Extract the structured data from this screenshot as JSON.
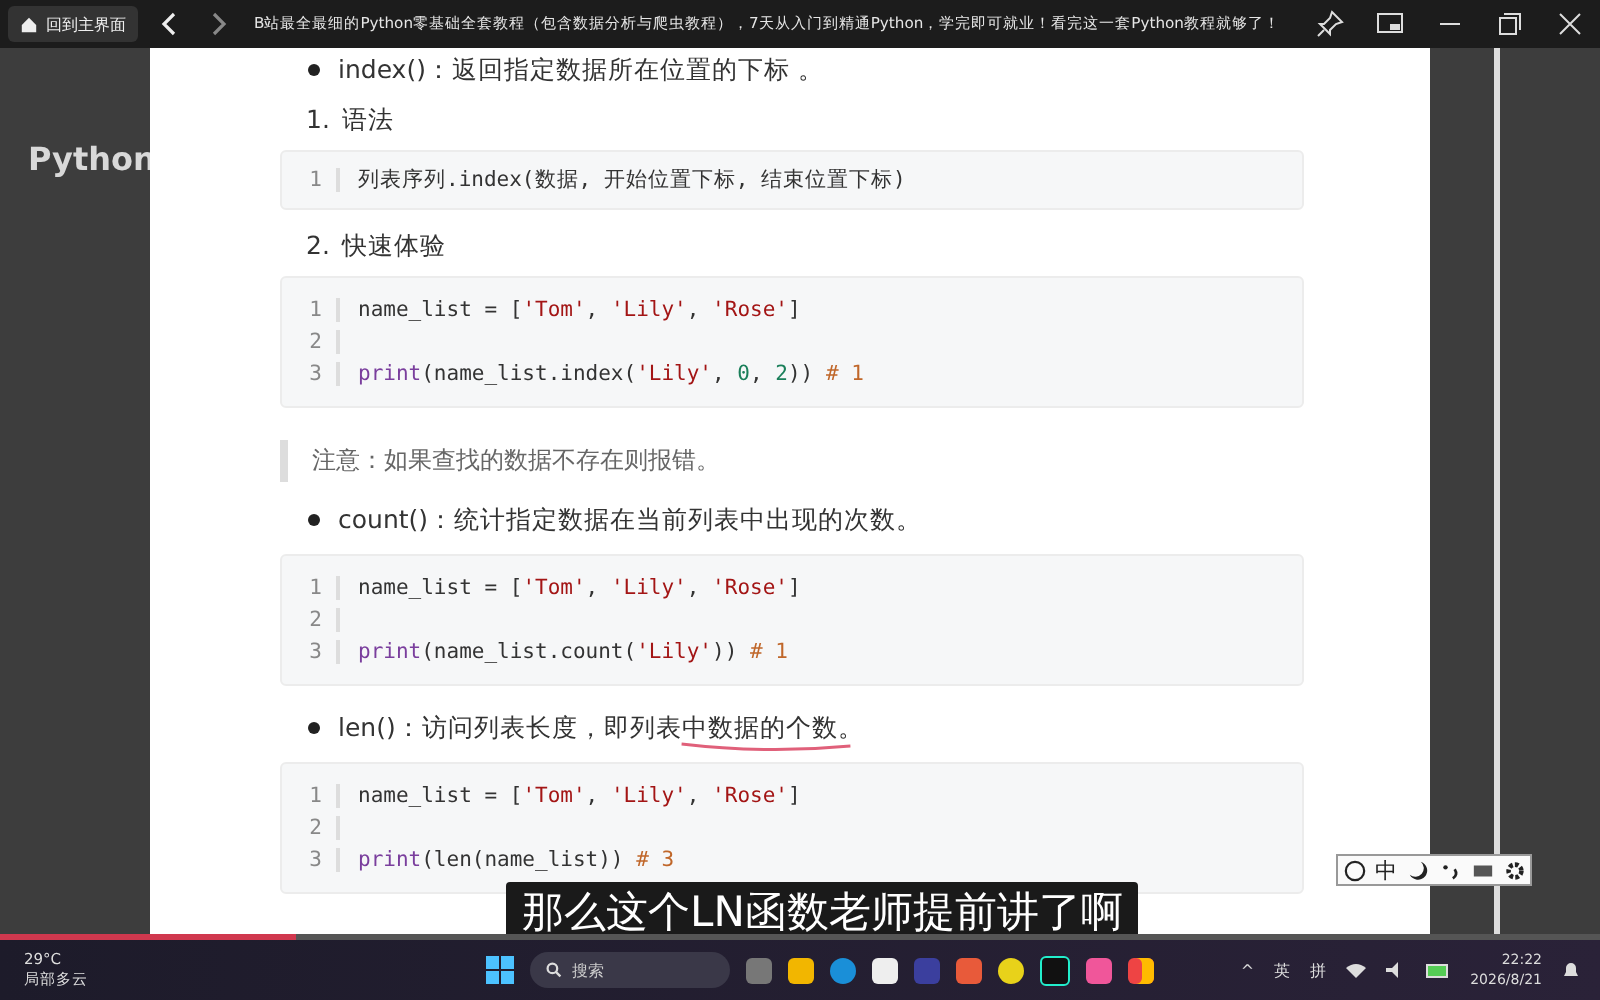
{
  "title_bar": {
    "home_button": "回到主界面",
    "title": "B站最全最细的Python零基础全套教程（包含数据分析与爬虫教程），7天从入门到精通Python，学完即可就业！看完这一套Python教程就够了！"
  },
  "video": {
    "side_caption": "Python",
    "blocks": [
      {
        "kind": "bullet",
        "text": "index()：返回指定数据所在位置的下标 。"
      },
      {
        "kind": "step",
        "number": "1.",
        "text": "语法"
      },
      {
        "kind": "code",
        "lines": [
          {
            "number": "1",
            "tokens": [
              {
                "kind": "plain",
                "text": "列表序列.index(数据, 开始位置下标, 结束位置下标)"
              }
            ]
          }
        ]
      },
      {
        "kind": "step",
        "number": "2.",
        "text": "快速体验"
      },
      {
        "kind": "code",
        "lines": [
          {
            "number": "1",
            "tokens": [
              {
                "kind": "plain",
                "text": "name_list = ["
              },
              {
                "kind": "str",
                "text": "'Tom'"
              },
              {
                "kind": "plain",
                "text": ", "
              },
              {
                "kind": "str",
                "text": "'Lily'"
              },
              {
                "kind": "plain",
                "text": ", "
              },
              {
                "kind": "str",
                "text": "'Rose'"
              },
              {
                "kind": "plain",
                "text": "]"
              }
            ]
          },
          {
            "number": "2"
          },
          {
            "number": "3",
            "tokens": [
              {
                "kind": "kw",
                "text": "print"
              },
              {
                "kind": "plain",
                "text": "(name_list.index("
              },
              {
                "kind": "str",
                "text": "'Lily'"
              },
              {
                "kind": "plain",
                "text": ", "
              },
              {
                "kind": "num",
                "text": "0"
              },
              {
                "kind": "plain",
                "text": ", "
              },
              {
                "kind": "num",
                "text": "2"
              },
              {
                "kind": "plain",
                "text": "))  "
              },
              {
                "kind": "comment",
                "text": "# 1"
              }
            ]
          }
        ]
      },
      {
        "kind": "note",
        "text": "注意：如果查找的数据不存在则报错。"
      },
      {
        "kind": "bullet",
        "text": "count()：统计指定数据在当前列表中出现的次数。"
      },
      {
        "kind": "code",
        "lines": [
          {
            "number": "1",
            "tokens": [
              {
                "kind": "plain",
                "text": "name_list = ["
              },
              {
                "kind": "str",
                "text": "'Tom'"
              },
              {
                "kind": "plain",
                "text": ", "
              },
              {
                "kind": "str",
                "text": "'Lily'"
              },
              {
                "kind": "plain",
                "text": ", "
              },
              {
                "kind": "str",
                "text": "'Rose'"
              },
              {
                "kind": "plain",
                "text": "]"
              }
            ]
          },
          {
            "number": "2"
          },
          {
            "number": "3",
            "tokens": [
              {
                "kind": "kw",
                "text": "print"
              },
              {
                "kind": "plain",
                "text": "(name_list.count("
              },
              {
                "kind": "str",
                "text": "'Lily'"
              },
              {
                "kind": "plain",
                "text": "))  "
              },
              {
                "kind": "comment",
                "text": "# 1"
              }
            ]
          }
        ]
      },
      {
        "kind": "bullet",
        "text": "len()：访问列表长度，即列表中数据的个数。",
        "underlined": true
      },
      {
        "kind": "code",
        "lines": [
          {
            "number": "1",
            "tokens": [
              {
                "kind": "plain",
                "text": "name_list = ["
              },
              {
                "kind": "str",
                "text": "'Tom'"
              },
              {
                "kind": "plain",
                "text": ", "
              },
              {
                "kind": "str",
                "text": "'Lily'"
              },
              {
                "kind": "plain",
                "text": ", "
              },
              {
                "kind": "str",
                "text": "'Rose'"
              },
              {
                "kind": "plain",
                "text": "]"
              }
            ]
          },
          {
            "number": "2"
          },
          {
            "number": "3",
            "tokens": [
              {
                "kind": "kw",
                "text": "print"
              },
              {
                "kind": "plain",
                "text": "(len(name_list))  "
              },
              {
                "kind": "comment",
                "text": "# 3"
              }
            ]
          }
        ]
      }
    ],
    "subtitle": "那么这个LN函数老师提前讲了啊",
    "ime_toolbar": {
      "mode": "中"
    },
    "progress": {
      "level": 0.185
    }
  },
  "taskbar": {
    "weather": {
      "temperature": "29°C",
      "condition": "局部多云"
    },
    "search_placeholder": "搜索",
    "tray": {
      "caret": "^",
      "language": "英",
      "input": "拼"
    },
    "clock": {
      "time": "22:22",
      "date": "2026/8/21"
    }
  }
}
